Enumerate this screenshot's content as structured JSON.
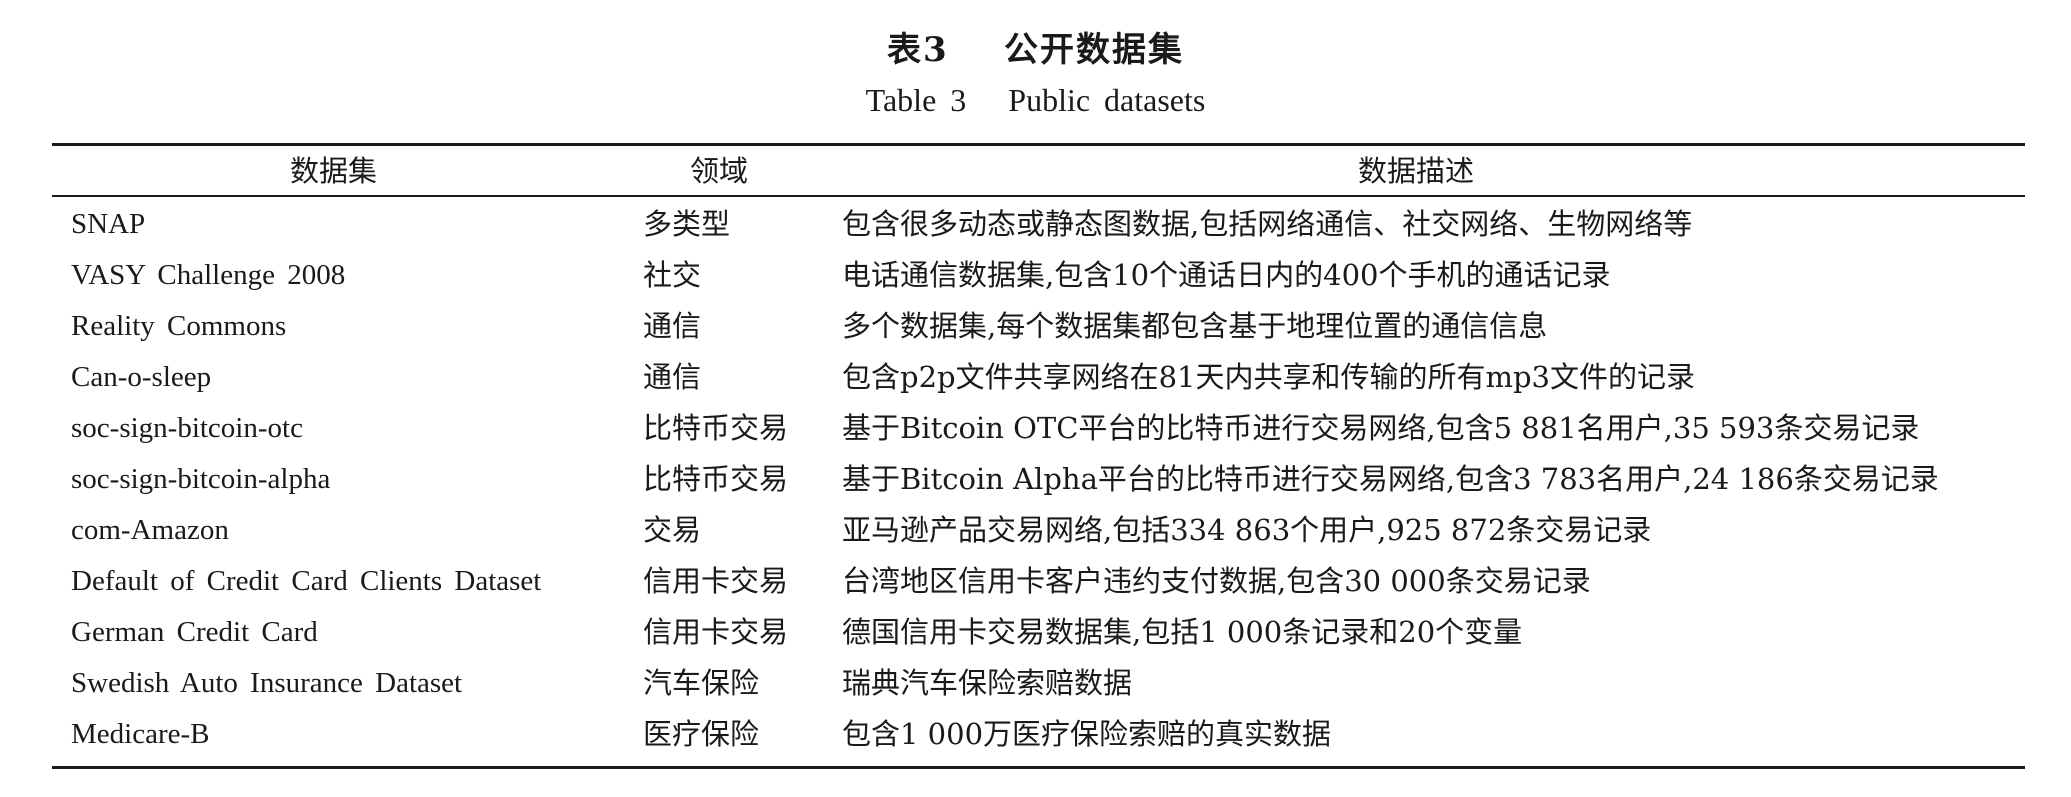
{
  "caption": {
    "chinese": "表3    公开数据集",
    "english": "Table 3   Public datasets"
  },
  "table": {
    "headers": [
      "数据集",
      "领域",
      "数据描述"
    ],
    "rows": [
      [
        "SNAP",
        "多类型",
        "包含很多动态或静态图数据,包括网络通信、社交网络、生物网络等"
      ],
      [
        "VASY Challenge 2008",
        "社交",
        "电话通信数据集,包含10个通话日内的400个手机的通话记录"
      ],
      [
        "Reality Commons",
        "通信",
        "多个数据集,每个数据集都包含基于地理位置的通信信息"
      ],
      [
        "Can-o-sleep",
        "通信",
        "包含p2p文件共享网络在81天内共享和传输的所有mp3文件的记录"
      ],
      [
        "soc-sign-bitcoin-otc",
        "比特币交易",
        "基于Bitcoin OTC平台的比特币进行交易网络,包含5 881名用户,35 593条交易记录"
      ],
      [
        "soc-sign-bitcoin-alpha",
        "比特币交易",
        "基于Bitcoin Alpha平台的比特币进行交易网络,包含3 783名用户,24 186条交易记录"
      ],
      [
        "com-Amazon",
        "交易",
        "亚马逊产品交易网络,包括334 863个用户,925 872条交易记录"
      ],
      [
        "Default of Credit Card Clients Dataset",
        "信用卡交易",
        "台湾地区信用卡客户违约支付数据,包含30 000条交易记录"
      ],
      [
        "German Credit Card",
        "信用卡交易",
        "德国信用卡交易数据集,包括1 000条记录和20个变量"
      ],
      [
        "Swedish Auto Insurance Dataset",
        "汽车保险",
        "瑞典汽车保险索赔数据"
      ],
      [
        "Medicare-B",
        "医疗保险",
        "包含1 000万医疗保险索赔的真实数据"
      ]
    ]
  }
}
